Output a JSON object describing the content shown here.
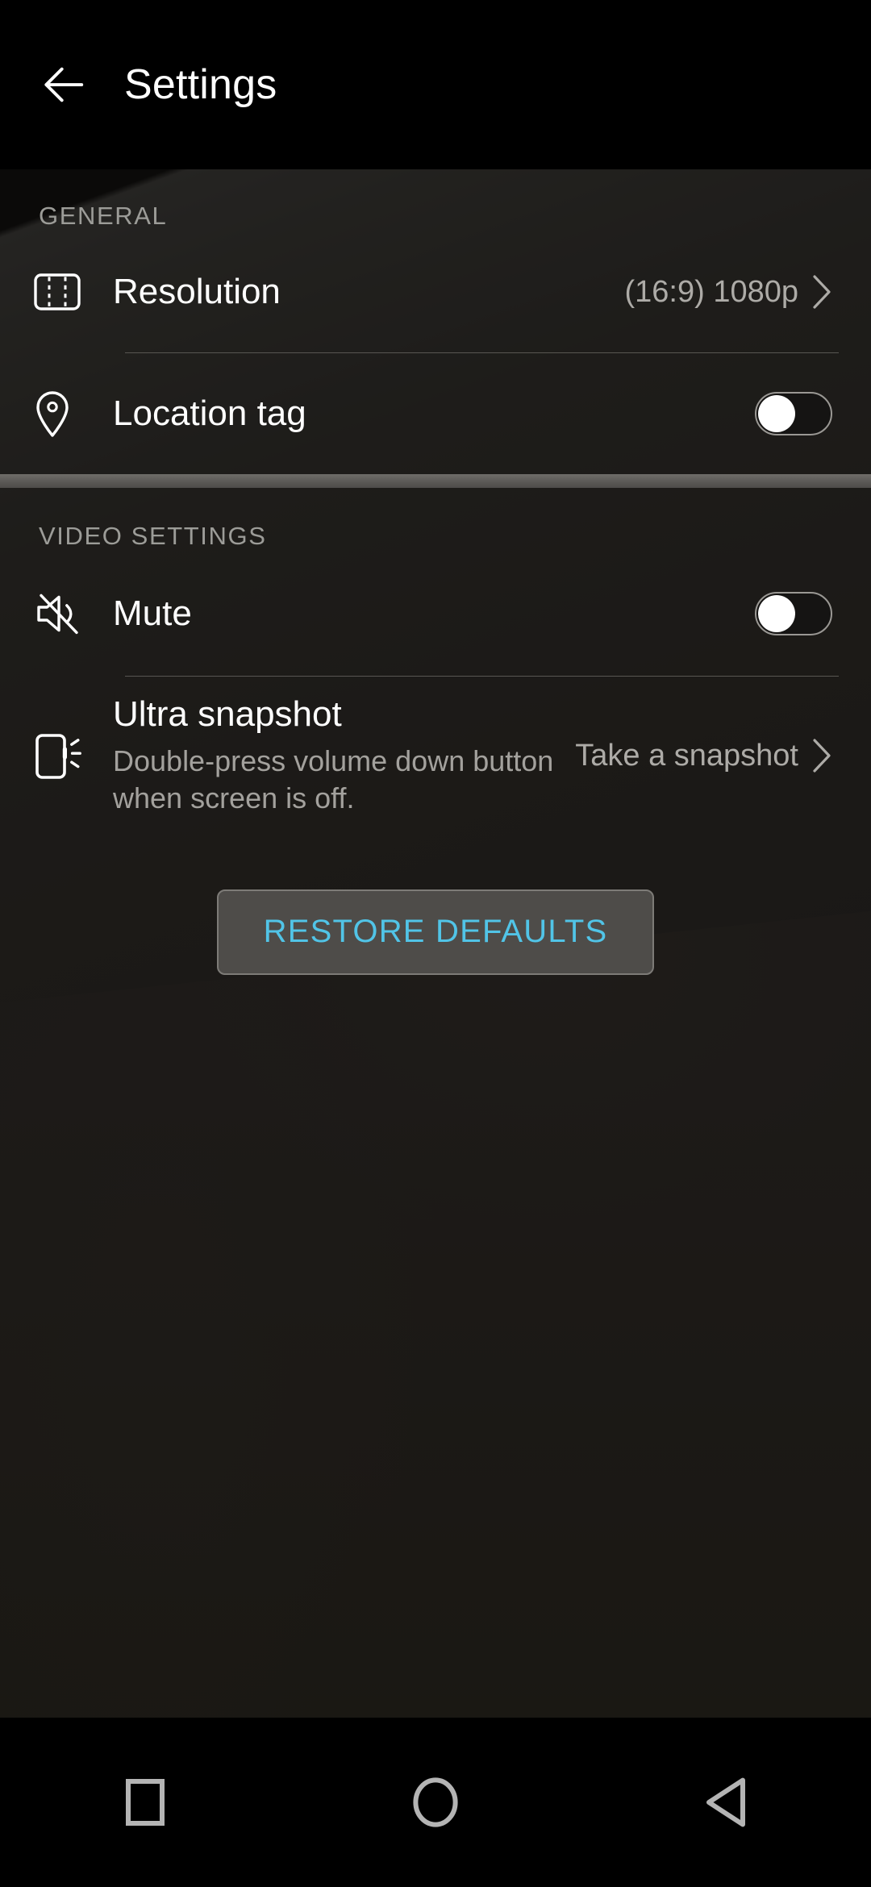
{
  "appbar": {
    "title": "Settings",
    "back_icon": "arrow-left-icon"
  },
  "sections": [
    {
      "label": "GENERAL",
      "rows": [
        {
          "icon": "film-strip-icon",
          "title": "Resolution",
          "value": "(16:9) 1080p",
          "control": "chevron"
        },
        {
          "icon": "location-pin-icon",
          "title": "Location tag",
          "control": "toggle",
          "toggle_state": "off"
        }
      ]
    },
    {
      "label": "VIDEO SETTINGS",
      "rows": [
        {
          "icon": "speaker-mute-icon",
          "title": "Mute",
          "control": "toggle",
          "toggle_state": "off"
        },
        {
          "icon": "phone-snapshot-icon",
          "title": "Ultra snapshot",
          "subtitle": "Double-press volume down button when screen is off.",
          "value": "Take a snapshot",
          "control": "chevron"
        }
      ]
    }
  ],
  "restore_button": {
    "label": "RESTORE DEFAULTS"
  },
  "navbar": {
    "recents_icon": "square-icon",
    "home_icon": "circle-icon",
    "back_icon": "triangle-left-icon"
  },
  "colors": {
    "accent": "#51c4e7",
    "title_text": "#ffffff",
    "secondary_text": "#a3a19d",
    "section_label": "#9c9c98",
    "divider": "#585652",
    "button_fill": "#4e4c49",
    "nav_icon": "#b4b4b4",
    "background": "#262320"
  }
}
